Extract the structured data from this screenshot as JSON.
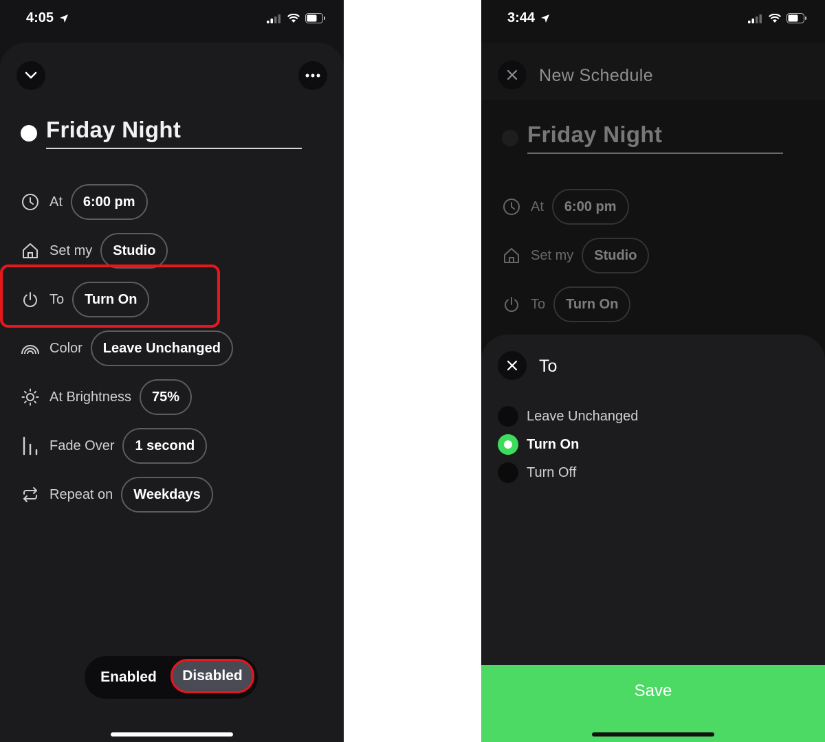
{
  "left": {
    "status_time": "4:05",
    "title": "Friday Night",
    "rows": [
      {
        "label": "At",
        "value": "6:00 pm",
        "icon": "clock-icon"
      },
      {
        "label": "Set my",
        "value": "Studio",
        "icon": "home-icon"
      },
      {
        "label": "To",
        "value": "Turn On",
        "icon": "power-icon"
      },
      {
        "label": "Color",
        "value": "Leave Unchanged",
        "icon": "rainbow-icon"
      },
      {
        "label": "At Brightness",
        "value": "75%",
        "icon": "sun-icon"
      },
      {
        "label": "Fade Over",
        "value": "1 second",
        "icon": "bars-icon"
      },
      {
        "label": "Repeat on",
        "value": "Weekdays",
        "icon": "repeat-icon"
      }
    ],
    "toggle": {
      "enabled": "Enabled",
      "disabled": "Disabled",
      "selected": "Disabled"
    },
    "highlight_color": "#e8161d"
  },
  "right": {
    "status_time": "3:44",
    "header_title": "New Schedule",
    "title": "Friday Night",
    "rows": [
      {
        "label": "At",
        "value": "6:00 pm"
      },
      {
        "label": "Set my",
        "value": "Studio"
      },
      {
        "label": "To",
        "value": "Turn On"
      }
    ],
    "sheet": {
      "title": "To",
      "options": [
        {
          "label": "Leave Unchanged",
          "selected": false
        },
        {
          "label": "Turn On",
          "selected": true
        },
        {
          "label": "Turn Off",
          "selected": false
        }
      ]
    },
    "save_label": "Save",
    "accent": "#4cd964"
  }
}
